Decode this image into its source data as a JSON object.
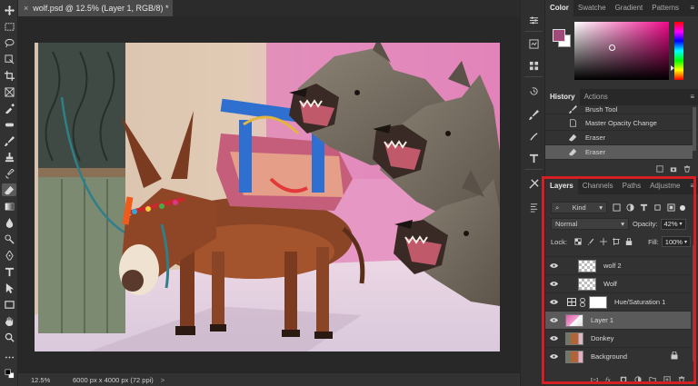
{
  "document": {
    "tab_title": "wolf.psd @ 12.5% (Layer 1, RGB/8) *",
    "close_glyph": "×"
  },
  "status": {
    "zoom": "12.5%",
    "dimensions": "6000 px x 4000 px (72 ppi)",
    "arrow": ">"
  },
  "color_panel": {
    "tabs": [
      "Color",
      "Swatche",
      "Gradient",
      "Patterns"
    ],
    "foreground": "#a14a7a",
    "background": "#ffffff"
  },
  "history_panel": {
    "tabs": [
      "History",
      "Actions"
    ],
    "items": [
      {
        "label": "Brush Tool",
        "icon": "brush-icon"
      },
      {
        "label": "Master Opacity Change",
        "icon": "doc-icon"
      },
      {
        "label": "Eraser",
        "icon": "eraser-icon"
      },
      {
        "label": "Eraser",
        "icon": "eraser-icon"
      }
    ]
  },
  "layers_panel": {
    "tabs": [
      "Layers",
      "Channels",
      "Paths",
      "Adjustme"
    ],
    "filter_kind": "Kind",
    "blend_mode": "Normal",
    "opacity_label": "Opacity:",
    "opacity_value": "42%",
    "lock_label": "Lock:",
    "fill_label": "Fill:",
    "fill_value": "100%",
    "layers": [
      {
        "name": "wolf 2",
        "thumb": "checker"
      },
      {
        "name": "Wolf",
        "thumb": "checker"
      },
      {
        "name": "Hue/Saturation 1",
        "thumb": "adjustment"
      },
      {
        "name": "Layer 1",
        "thumb": "pink",
        "selected": true
      },
      {
        "name": "Donkey",
        "thumb": "photo"
      },
      {
        "name": "Background",
        "thumb": "photo",
        "locked": true
      }
    ]
  },
  "colors": {
    "highlight": "#d41f25",
    "accent_pink": "#e05aa8"
  }
}
